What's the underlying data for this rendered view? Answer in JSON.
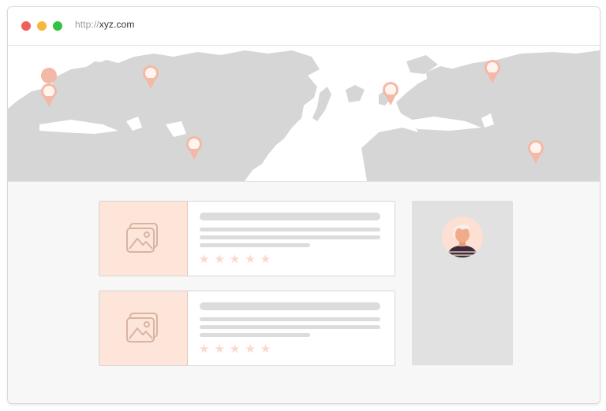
{
  "browser": {
    "url_protocol": "http://",
    "url_domain": "xyz.com",
    "traffic_lights": {
      "close": "#f25f57",
      "minimize": "#f6b73c",
      "maximize": "#32c241"
    }
  },
  "map": {
    "land_color": "#d6d6d6",
    "pin_color": "#f3b8a6",
    "pin_count": 7
  },
  "cards": [
    {
      "thumbnail_icon": "image-icon",
      "rating_stars": "★★★★★"
    },
    {
      "thumbnail_icon": "image-icon",
      "rating_stars": "★★★★★"
    }
  ],
  "sidebar": {
    "avatar_icon": "user-avatar-icon",
    "colors": {
      "background": "#e1e1e1",
      "avatar_bg": "#fde0d3"
    }
  },
  "colors": {
    "thumbnail_bg": "#fde5d9",
    "placeholder_line": "#dcdcdc",
    "star": "#fbd9c6"
  }
}
